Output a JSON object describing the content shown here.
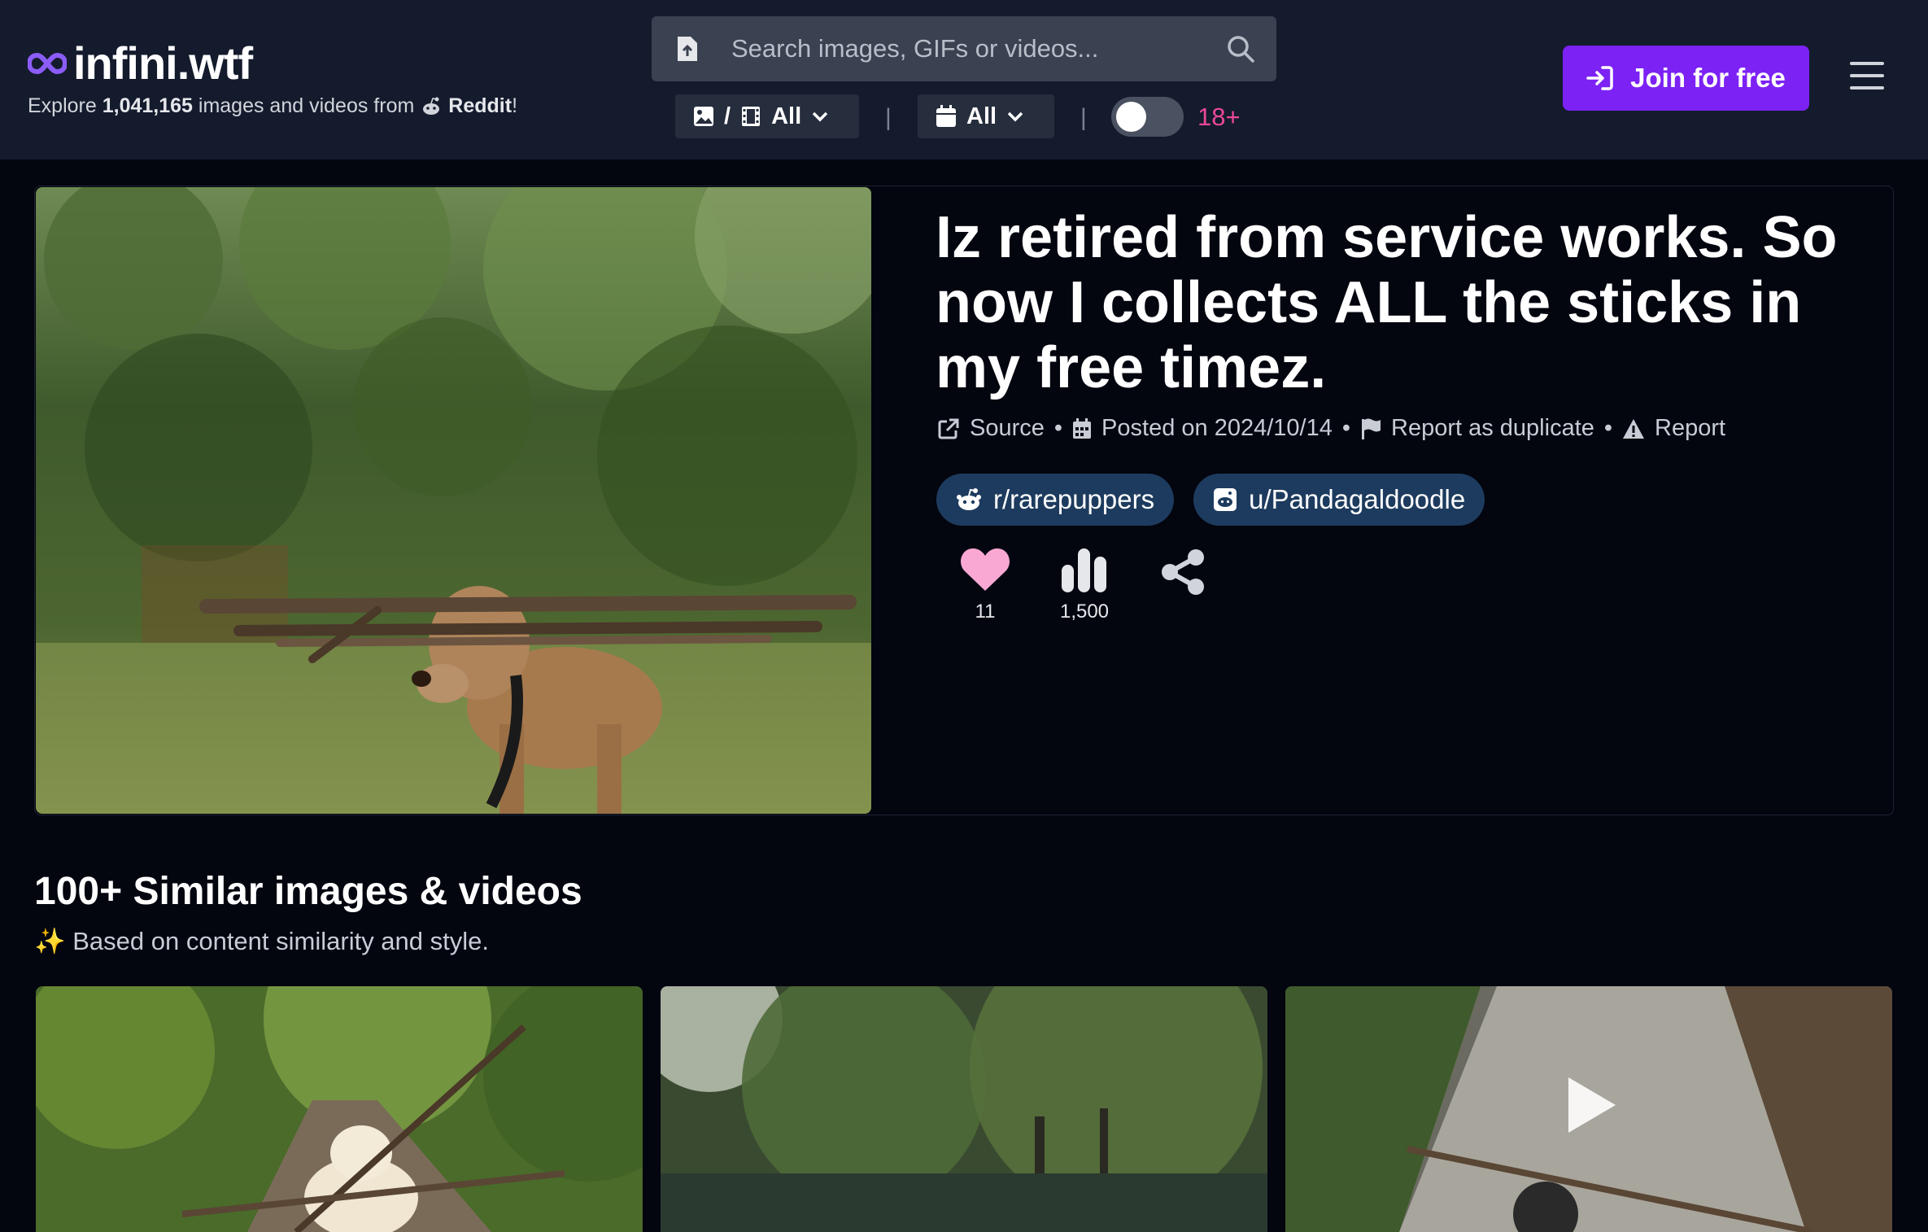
{
  "header": {
    "logo_text": "infini.wtf",
    "tagline_prefix": "Explore",
    "tagline_count": "1,041,165",
    "tagline_middle": "images and videos from",
    "tagline_source": "Reddit",
    "tagline_suffix": "!",
    "search_placeholder": "Search images, GIFs or videos...",
    "media_filter_slash": "/",
    "media_filter_label": "All",
    "date_filter_label": "All",
    "separator": "|",
    "nsfw_label": "18+",
    "nsfw_enabled": false,
    "join_label": "Join for free",
    "accent_color": "#7c22f5"
  },
  "post": {
    "title": "Iz retired from service works. So now I collects ALL the sticks in my free timez.",
    "source_label": "Source",
    "posted_label": "Posted on 2024/10/14",
    "duplicate_label": "Report as duplicate",
    "report_label": "Report",
    "meta_dot": "•",
    "subreddit": "r/rarepuppers",
    "user": "u/Pandagaldoodle",
    "likes": "11",
    "views": "1,500",
    "image_alt": "Dog carrying large sticks in forest"
  },
  "similar": {
    "title": "100+ Similar images & videos",
    "subtitle_icon": "✨",
    "subtitle": "Based on content similarity and style."
  }
}
